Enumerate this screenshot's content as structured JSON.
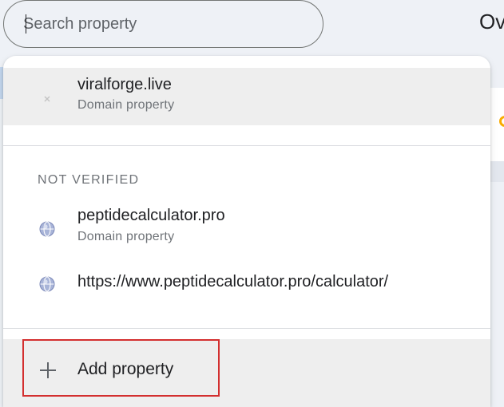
{
  "background": {
    "page_title": "Ov"
  },
  "search": {
    "placeholder": "Search property",
    "value": ""
  },
  "dropdown": {
    "current": {
      "name": "viralforge.live",
      "type": "Domain property",
      "icon": "crossed-out-icon"
    },
    "not_verified_label": "NOT VERIFIED",
    "not_verified": [
      {
        "name": "peptidecalculator.pro",
        "type": "Domain property",
        "icon": "globe-icon"
      },
      {
        "name": "https://www.peptidecalculator.pro/calculator/",
        "icon": "globe-icon"
      }
    ],
    "add_property_label": "Add property"
  },
  "colors": {
    "highlight_border": "#d32f2f",
    "selected_row": "#eeeeee",
    "accent_warning": "#f9ab00"
  }
}
